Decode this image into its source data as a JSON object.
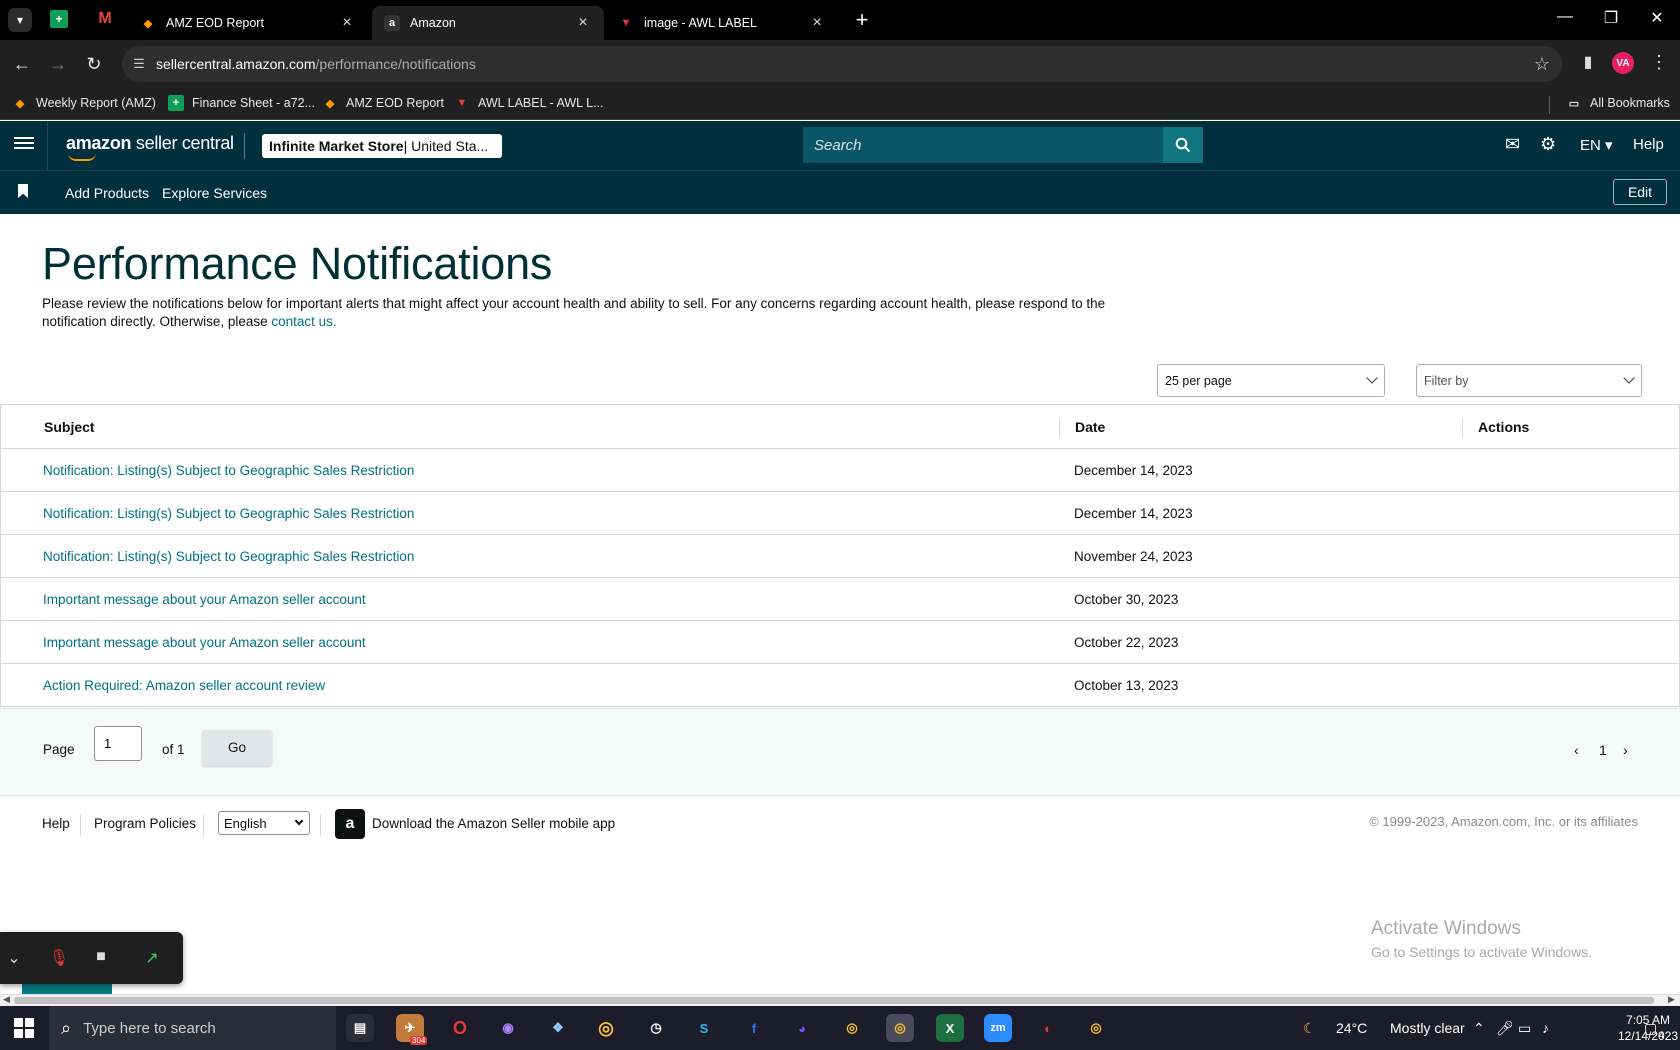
{
  "browser": {
    "tabs": [
      {
        "title": "AMZ EOD Report",
        "favicon": "eod-report-icon"
      },
      {
        "title": "Amazon",
        "favicon": "amazon-icon",
        "active": true
      },
      {
        "title": "image - AWL LABEL",
        "favicon": "awl-label-icon"
      }
    ],
    "url_host": "sellercentral.amazon.com",
    "url_path": "/performance/notifications",
    "profile_initials": "VA",
    "bookmarks": [
      {
        "label": "Weekly Report (AMZ)"
      },
      {
        "label": "Finance Sheet - a72..."
      },
      {
        "label": "AMZ EOD Report"
      },
      {
        "label": "AWL LABEL - AWL L..."
      }
    ],
    "all_bookmarks": "All Bookmarks"
  },
  "header": {
    "logo_brand": "amazon",
    "logo_text": " seller central",
    "store_name": "Infinite Market Store",
    "store_region": " | United Sta...",
    "search_placeholder": "Search",
    "language": "EN",
    "help": "Help"
  },
  "subnav": {
    "add_products": "Add Products",
    "explore_services": "Explore Services",
    "edit": "Edit"
  },
  "page": {
    "title": "Performance Notifications",
    "description": "Please review the notifications below for important alerts that might affect your account health and ability to sell. For any concerns regarding account health, please respond to the notification directly. Otherwise, please ",
    "contact_link": "contact us.",
    "per_page": "25 per page",
    "filter_by": "Filter by"
  },
  "table": {
    "columns": {
      "subject": "Subject",
      "date": "Date",
      "actions": "Actions"
    },
    "rows": [
      {
        "subject": "Notification: Listing(s) Subject to Geographic Sales Restriction",
        "date": "December 14, 2023"
      },
      {
        "subject": "Notification: Listing(s) Subject to Geographic Sales Restriction",
        "date": "December 14, 2023"
      },
      {
        "subject": "Notification: Listing(s) Subject to Geographic Sales Restriction",
        "date": "November 24, 2023"
      },
      {
        "subject": "Important message about your Amazon seller account",
        "date": "October 30, 2023"
      },
      {
        "subject": "Important message about your Amazon seller account",
        "date": "October 22, 2023"
      },
      {
        "subject": "Action Required: Amazon seller account review",
        "date": "October 13, 2023"
      }
    ]
  },
  "pagination": {
    "page_label": "Page",
    "page_value": "1",
    "of_label": "of 1",
    "go": "Go",
    "current_page": "1"
  },
  "footer": {
    "help": "Help",
    "program_policies": "Program Policies",
    "language": "English",
    "download_app": "Download the Amazon Seller mobile app",
    "copyright": "© 1999-2023, Amazon.com, Inc. or its affiliates"
  },
  "watermark": {
    "line1": "Activate Windows",
    "line2": "Go to Settings to activate Windows."
  },
  "taskbar": {
    "search_placeholder": "Type here to search",
    "telegram_badge": "304",
    "weather_temp": "24°C",
    "weather_text": "Mostly clear",
    "time": "7:05 AM",
    "date": "12/14/2023",
    "notification_count": "4"
  }
}
